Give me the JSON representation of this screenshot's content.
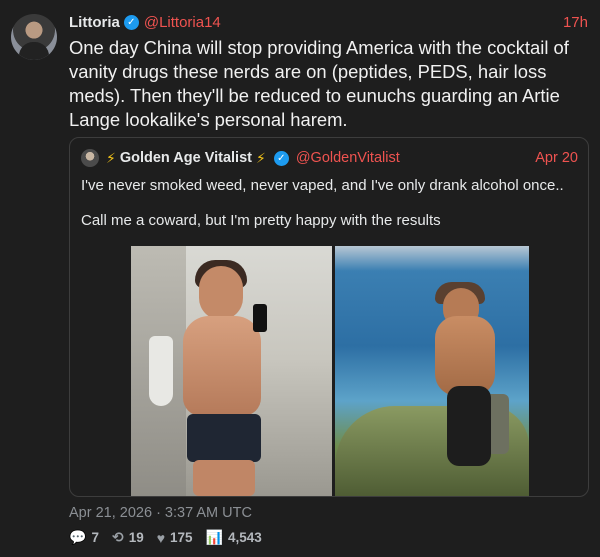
{
  "post": {
    "author_name": "Littoria",
    "author_handle": "@Littoria14",
    "time": "17h",
    "text": "One day China will stop providing America with the cocktail of vanity drugs these nerds are on (peptides, PEDS, hair loss meds). Then they'll be reduced to eunuchs guarding an Artie Lange lookalike's personal harem.",
    "date": "Apr 21, 2026 · 3:37 AM UTC",
    "stats": {
      "replies": "7",
      "retweets": "19",
      "likes": "175",
      "views": "4,543"
    }
  },
  "quote": {
    "bolt_left": "⚡",
    "author_name": "Golden Age Vitalist",
    "bolt_right": "⚡",
    "author_handle": "@GoldenVitalist",
    "time": "Apr 20",
    "line1": "I've never smoked weed, never vaped, and I've only drank alcohol once..",
    "line2": "Call me a coward, but I'm pretty happy with the results"
  },
  "icons": {
    "verified": "✓",
    "reply": "💬",
    "retweet": "⟲",
    "like": "♥",
    "views": "📊"
  },
  "colors": {
    "background": "#1e1e1e",
    "handle": "#ef5350",
    "verified": "#1d9bf0"
  }
}
